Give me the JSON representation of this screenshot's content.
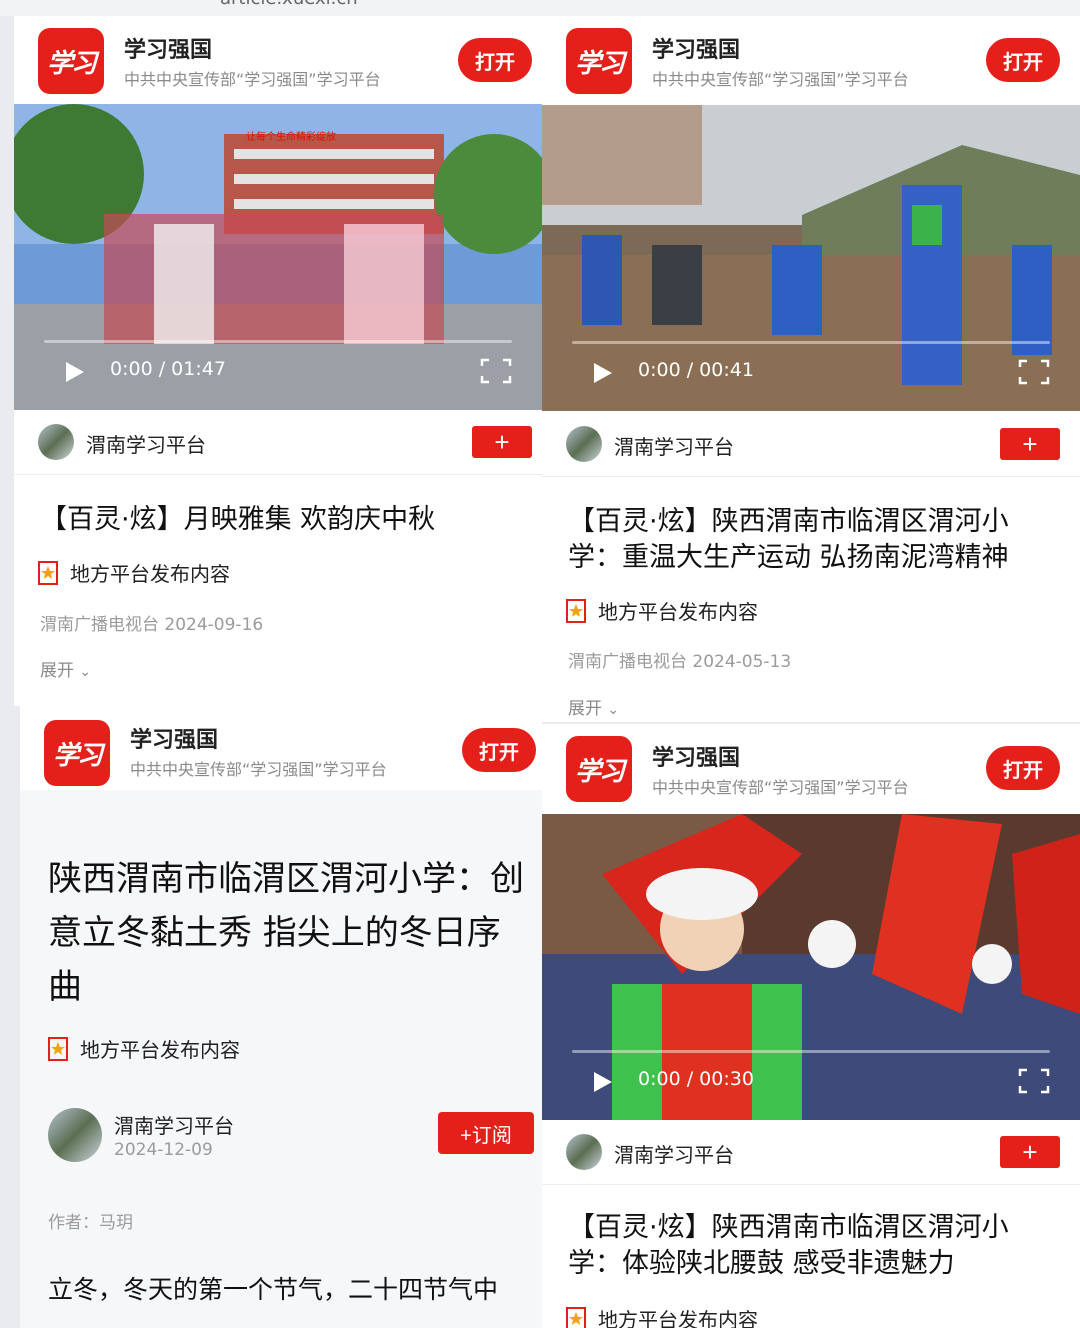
{
  "top_url": "article.xuexi.cn",
  "cards": [
    {
      "app_name": "学习强国",
      "app_sub": "中共中央宣传部“学习强国”学习平台",
      "open_label": "打开",
      "logo_text": "学习",
      "video": {
        "time": "0:00 / 01:47",
        "progress": 0.0,
        "banner_text": "让每个生命精彩绽放"
      },
      "source_name": "渭南学习平台",
      "follow_label": "+",
      "title": "【百灵·炫】月映雅集 欢韵庆中秋",
      "tag": "地方平台发布内容",
      "meta": "渭南广播电视台  2024-09-16",
      "expand_label": "展开"
    },
    {
      "app_name": "学习强国",
      "app_sub": "中共中央宣传部“学习强国”学习平台",
      "open_label": "打开",
      "logo_text": "学习",
      "video": {
        "time": "0:00 / 00:41",
        "progress": 0.0
      },
      "source_name": "渭南学习平台",
      "follow_label": "+",
      "title": "【百灵·炫】陕西渭南市临渭区渭河小学：重温大生产运动 弘扬南泥湾精神",
      "tag": "地方平台发布内容",
      "meta": "渭南广播电视台  2024-05-13",
      "expand_label": "展开"
    },
    {
      "app_name": "学习强国",
      "app_sub": "中共中央宣传部“学习强国”学习平台",
      "open_label": "打开",
      "logo_text": "学习",
      "title": "陕西渭南市临渭区渭河小学：创意立冬黏土秀 指尖上的冬日序曲",
      "tag": "地方平台发布内容",
      "source_name": "渭南学习平台",
      "source_date": "2024-12-09",
      "subscribe_label": "+订阅",
      "author": "作者：马玥",
      "body_text": "立冬，冬天的第一个节气，二十四节气中"
    },
    {
      "app_name": "学习强国",
      "app_sub": "中共中央宣传部“学习强国”学习平台",
      "open_label": "打开",
      "logo_text": "学习",
      "video": {
        "time": "0:00 / 00:30",
        "progress": 0.0
      },
      "source_name": "渭南学习平台",
      "follow_label": "+",
      "title": "【百灵·炫】陕西渭南市临渭区渭河小学：体验陕北腰鼓 感受非遗魅力",
      "tag": "地方平台发布内容"
    }
  ],
  "colors": {
    "accent": "#e5201a",
    "muted": "#9b9b9b"
  }
}
